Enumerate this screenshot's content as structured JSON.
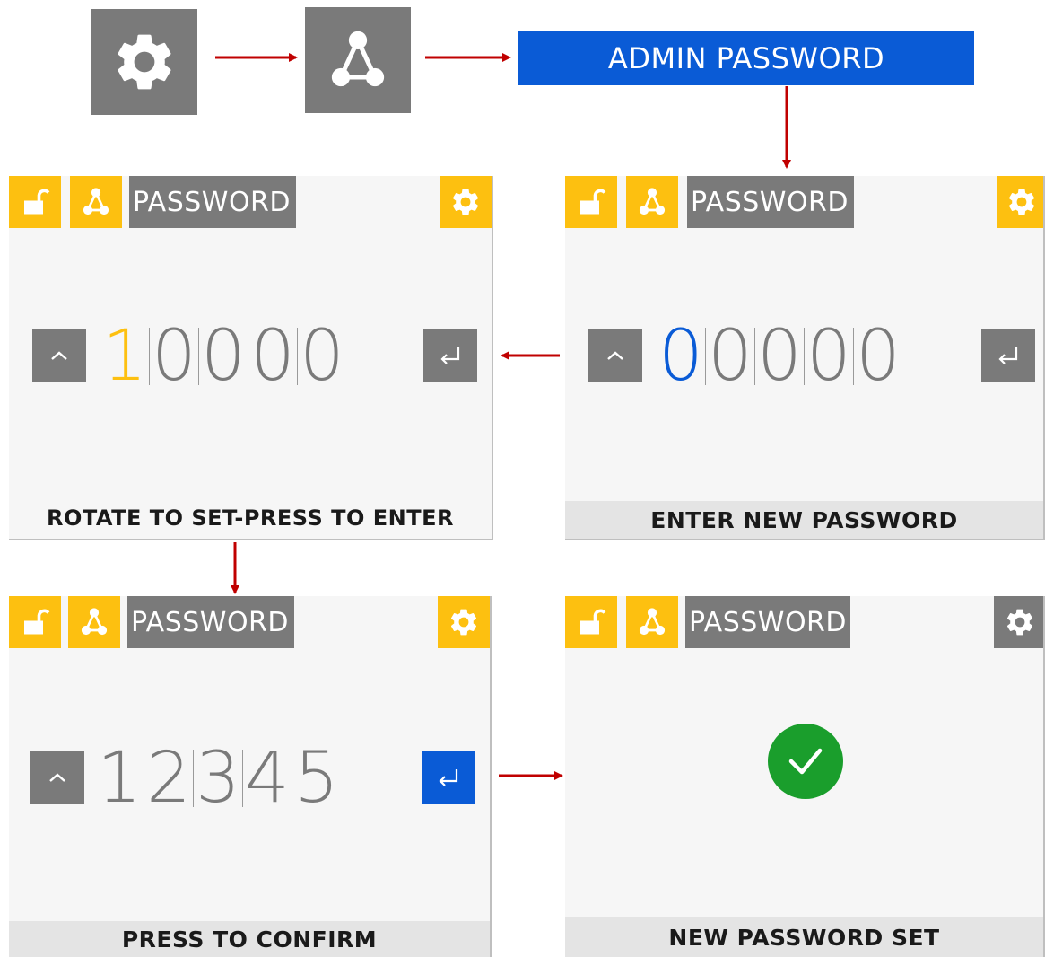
{
  "flow": {
    "start_icon": "gear-icon",
    "network_icon": "network-icon",
    "admin_button_label": "ADMIN PASSWORD"
  },
  "colors": {
    "yellow": "#fdc010",
    "grey": "#7a7a7a",
    "blue": "#0a5bd6",
    "green": "#1a9e2c",
    "arrow_red": "#c00000"
  },
  "screens": {
    "enter_new": {
      "title": "PASSWORD",
      "digits": [
        "0",
        "0",
        "0",
        "0",
        "0"
      ],
      "active_digit_index": 0,
      "footer": "ENTER NEW PASSWORD"
    },
    "rotate_set": {
      "title": "PASSWORD",
      "digits": [
        "1",
        "0",
        "0",
        "0",
        "0"
      ],
      "active_digit_index": 0,
      "footer": "ROTATE TO SET-PRESS TO ENTER"
    },
    "confirm": {
      "title": "PASSWORD",
      "digits": [
        "1",
        "2",
        "3",
        "4",
        "5"
      ],
      "footer": "PRESS TO CONFIRM"
    },
    "done": {
      "title": "PASSWORD",
      "footer": "NEW PASSWORD SET"
    }
  }
}
